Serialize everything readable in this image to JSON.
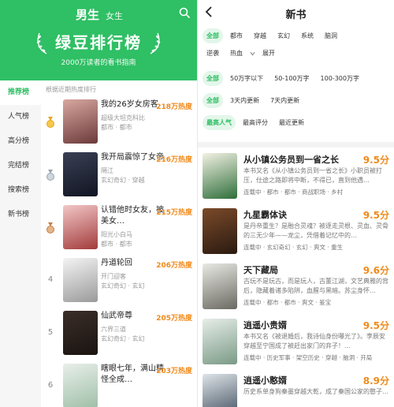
{
  "left": {
    "header": {
      "tab_active": "男生",
      "tab_inactive": "女生",
      "title": "绿豆排行榜",
      "subtitle": "2000万读者的看书指南",
      "bg": "#2fbf64"
    },
    "sidebar": [
      "推荐榜",
      "人气榜",
      "高分榜",
      "完结榜",
      "搜索榜",
      "新书榜"
    ],
    "hint": "根据近期热度排行",
    "books": [
      {
        "rank": "",
        "medal": "gold",
        "title": "我的26岁女房客",
        "author": "超级大坦克科比",
        "tags": "都市 · 都市",
        "heat": "218万热度",
        "cover": [
          "#d8a7a0",
          "#6b3a3a"
        ]
      },
      {
        "rank": "",
        "medal": "silver",
        "title": "我开局震惊了女帝",
        "author": "隔江",
        "tags": "玄幻奇幻 · 穿越",
        "heat": "216万热度",
        "cover": [
          "#3a3f55",
          "#111522"
        ]
      },
      {
        "rank": "",
        "medal": "bronze",
        "title": "认错他时女友，被美女…",
        "author": "阳光小白马",
        "tags": "都市 · 都市",
        "heat": "215万热度",
        "cover": [
          "#f2c7c7",
          "#a33b3b"
        ]
      },
      {
        "rank": "4",
        "medal": "",
        "title": "丹道轮回",
        "author": "开门迎客",
        "tags": "玄幻奇幻 · 玄幻",
        "heat": "206万热度",
        "cover": [
          "#f4f4f4",
          "#9a9a9a"
        ]
      },
      {
        "rank": "5",
        "medal": "",
        "title": "仙武帝尊",
        "author": "六界三道",
        "tags": "玄幻奇幻 · 玄幻",
        "heat": "205万热度",
        "cover": [
          "#3b2e28",
          "#1a1411"
        ]
      },
      {
        "rank": "6",
        "medal": "",
        "title": "瞎眼七年，满山精怪全成…",
        "author": "",
        "tags": "",
        "heat": "203万热度",
        "cover": [
          "#e8efe9",
          "#9fbfa8"
        ]
      }
    ]
  },
  "right": {
    "title": "新书",
    "filters": [
      [
        "全部",
        "都市",
        "穿越",
        "玄幻",
        "系统",
        "脑洞"
      ],
      [
        "逆袭",
        "热血",
        "展开"
      ],
      [
        "全部",
        "50万字以下",
        "50-100万字",
        "100-300万字"
      ],
      [
        "全部",
        "3天内更新",
        "7天内更新"
      ],
      [
        "最高人气",
        "最高评分",
        "最近更新"
      ]
    ],
    "books": [
      {
        "title": "从小镇公务员到一省之长",
        "score": "9.5分",
        "desc": "本书又名《从小镇公务员到一省之长》小职员被打压，仕途之路即将中断，不得已，直到他遇…",
        "tags": "连载中 · 都市 · 都市 · 商战职场 · 乡村",
        "cover": [
          "#f3f1e4",
          "#2f6f3a"
        ]
      },
      {
        "title": "九星霸体诀",
        "score": "9.5分",
        "desc": "是丹帝重生？是融合灵魂？被逐走灵根、灵血、灵骨的三无少年——龙尘，凭借着记忆中的…",
        "tags": "连载中 · 玄幻奇幻 · 玄幻 · 爽文 · 重生",
        "cover": [
          "#7b4a2a",
          "#2a1a10"
        ]
      },
      {
        "title": "天下藏局",
        "score": "9.6分",
        "desc": "古玩不是玩古，而是玩人，古董江湖，文艺典雅的背后，隐藏着诸多陷阱，血腥与黑暗。苏尘身怀…",
        "tags": "连载中 · 都市 · 都市 · 爽文 · 鉴宝",
        "cover": [
          "#e9e9e4",
          "#6a6a62"
        ]
      },
      {
        "title": "逍遥小贵婿",
        "score": "9.5分",
        "desc": "本书又名《被退婚后，我诗仙身份曝光了》。李辰安穿越至宁国成了被赶出家门的弃子！…",
        "tags": "连载中 · 历史军事 · 架空历史 · 穿越 · 脑洞 · 开局",
        "cover": [
          "#e6ede8",
          "#7a9a86"
        ]
      },
      {
        "title": "逍遥小憨婿",
        "score": "8.9分",
        "desc": "历史系单身狗秦墨穿越大乾，成了秦国公家的憨子…",
        "tags": "",
        "cover": [
          "#dfe4e8",
          "#3b4a5a"
        ]
      }
    ]
  }
}
